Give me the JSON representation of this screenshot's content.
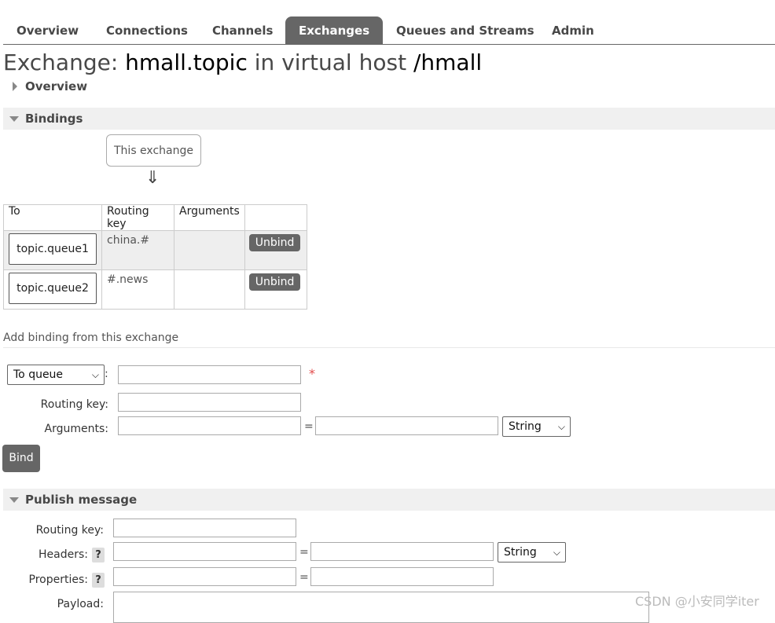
{
  "tabs": [
    {
      "label": "Overview",
      "active": false
    },
    {
      "label": "Connections",
      "active": false
    },
    {
      "label": "Channels",
      "active": false
    },
    {
      "label": "Exchanges",
      "active": true
    },
    {
      "label": "Queues and Streams",
      "active": false
    },
    {
      "label": "Admin",
      "active": false
    }
  ],
  "page": {
    "title_prefix": "Exchange:",
    "exchange_name": "hmall.topic",
    "title_middle": "in virtual host",
    "vhost": "/hmall"
  },
  "sections": {
    "overview": "Overview",
    "bindings": "Bindings",
    "publish": "Publish message"
  },
  "bindings": {
    "this_exchange": "This exchange",
    "arrow": "⇓",
    "headers": [
      "To",
      "Routing key",
      "Arguments",
      ""
    ],
    "rows": [
      {
        "to": "topic.queue1",
        "routing_key": "china.#",
        "arguments": "",
        "action": "Unbind"
      },
      {
        "to": "topic.queue2",
        "routing_key": "#.news",
        "arguments": "",
        "action": "Unbind"
      }
    ]
  },
  "add_binding": {
    "heading": "Add binding from this exchange",
    "destination_type": "To queue",
    "destination_value": "",
    "required_mark": "*",
    "routing_key_label": "Routing key:",
    "routing_key_value": "",
    "arguments_label": "Arguments:",
    "arg_key": "",
    "arg_value": "",
    "arg_type": "String",
    "bind_label": "Bind"
  },
  "publish": {
    "routing_key_label": "Routing key:",
    "headers_label": "Headers:",
    "headers_type": "String",
    "properties_label": "Properties:",
    "payload_label": "Payload:",
    "help": "?",
    "equals": "="
  },
  "watermark": "CSDN @小安同学iter",
  "colors": {
    "tab_active_bg": "#666666",
    "button_bg": "#666666",
    "section_bg": "#f0f0f0",
    "required": "#e24b4b"
  }
}
